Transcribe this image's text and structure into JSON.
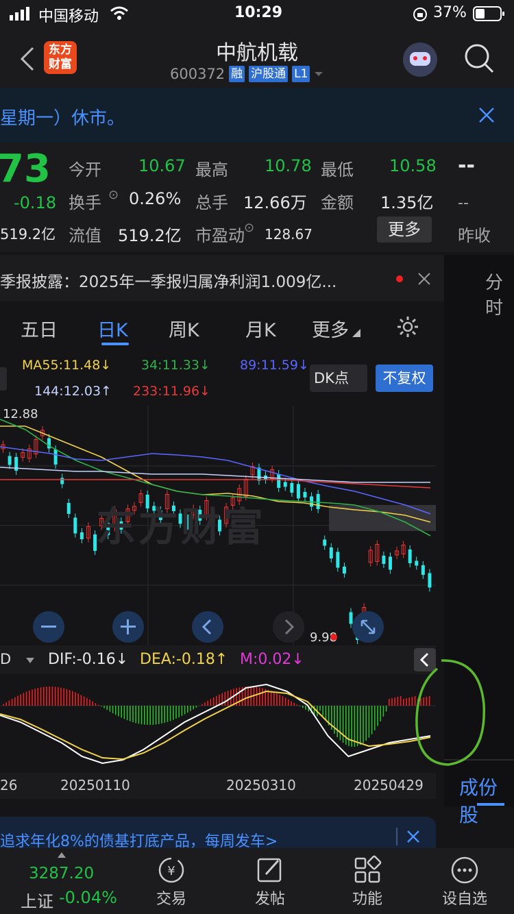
{
  "status": {
    "carrier": "中国移动",
    "time": "10:29",
    "battery": "37%"
  },
  "header": {
    "logo_text": "东方\n财富",
    "title": "中航机载",
    "code": "600372",
    "badges": [
      "融",
      "沪股通",
      "L1"
    ]
  },
  "notice": {
    "text": "星期一）休市。"
  },
  "quote": {
    "price_partial": "73",
    "change": "-0.18",
    "mktcap_partial": "519.2亿",
    "rows": [
      [
        {
          "label": "今开",
          "value": "10.67"
        },
        {
          "label": "最高",
          "value": "10.78"
        },
        {
          "label": "最低",
          "value": "10.58"
        }
      ],
      [
        {
          "label": "换手",
          "value": "0.26%"
        },
        {
          "label": "总手",
          "value": "12.66万"
        },
        {
          "label": "金额",
          "value": "1.35亿"
        }
      ],
      [
        {
          "label": "流值",
          "value": "519.2亿"
        },
        {
          "label": "市盈动",
          "value": "128.67"
        }
      ]
    ],
    "more_button": "更多",
    "right_top": "--",
    "right_mid": "--",
    "right_label": "昨收"
  },
  "news": {
    "text": "季报披露：2025年一季报归属净利润1.009亿..."
  },
  "side": {
    "label_top": "分时",
    "label_bottom": "成份股"
  },
  "tabs": [
    "五日",
    "日K",
    "周K",
    "月K",
    "更多"
  ],
  "indicators": {
    "ma55": "MA55:11.48↓",
    "ma34": "34:11.33↓",
    "ma89": "89:11.59↓",
    "ma144": "144:12.03↑",
    "ma233": "233:11.96↓",
    "dk_button": "DK点",
    "fuquan_button": "不复权"
  },
  "chart": {
    "high_label": "12.88",
    "low_label": "9.98",
    "watermark": "东方财富"
  },
  "macd": {
    "dif": "DIF:-0.16↓",
    "dea": "DEA:-0.18↑",
    "m": "M:0.02↓",
    "sel": "D"
  },
  "dates": [
    "26",
    "20250110",
    "20250310",
    "20250429"
  ],
  "ad": {
    "text": "追求年化8%的债基打底产品，每周发车>"
  },
  "bottom": {
    "index_value": "3287.20",
    "index_name": "上证",
    "index_change": "-0.04%",
    "nav": [
      "交易",
      "发帖",
      "功能",
      "设自选"
    ]
  }
}
